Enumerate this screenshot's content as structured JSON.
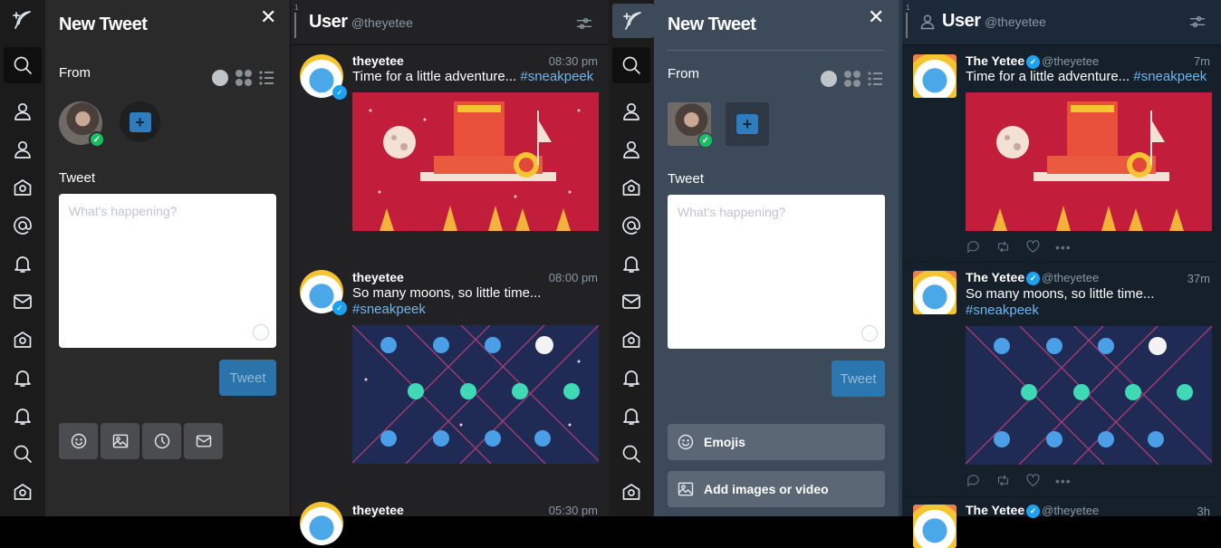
{
  "compose_left": {
    "title": "New Tweet",
    "from_label": "From",
    "tweet_label": "Tweet",
    "placeholder": "What's happening?",
    "tweet_button": "Tweet"
  },
  "compose_right": {
    "title": "New Tweet",
    "from_label": "From",
    "tweet_label": "Tweet",
    "placeholder": "What's happening?",
    "tweet_button": "Tweet",
    "emojis_label": "Emojis",
    "add_media_label": "Add images or video"
  },
  "nav_icons": [
    "search-icon",
    "user-icon",
    "user-icon",
    "home-icon",
    "mention-icon",
    "bell-icon",
    "mail-icon",
    "home-icon",
    "bell-icon",
    "bell-icon",
    "search-icon",
    "home-icon"
  ],
  "column_left": {
    "number": "1",
    "title": "User",
    "handle": "@theyetee",
    "tweets": [
      {
        "name": "theyetee",
        "time": "08:30 pm",
        "text": "Time for a little adventure...",
        "hashtag": "#sneakpeek"
      },
      {
        "name": "theyetee",
        "time": "08:00 pm",
        "text": "So many moons, so little time...",
        "hashtag": "#sneakpeek"
      },
      {
        "name": "theyetee",
        "time": "05:30 pm"
      }
    ]
  },
  "column_right": {
    "number": "1",
    "title": "User",
    "handle": "@theyetee",
    "tweets": [
      {
        "name": "The Yetee",
        "handle": "@theyetee",
        "time": "7m",
        "text": "Time for a little adventure...",
        "hashtag": "#sneakpeek"
      },
      {
        "name": "The Yetee",
        "handle": "@theyetee",
        "time": "37m",
        "text": "So many moons, so little time...",
        "hashtag": "#sneakpeek"
      },
      {
        "name": "The Yetee",
        "handle": "@theyetee",
        "time": "3h"
      }
    ]
  },
  "colors": {
    "compose_dark": "#2a2a2b",
    "compose_blue": "#3d4a59",
    "column_dark": "#222224",
    "column_navy": "#15202b",
    "link": "#6fb6ee",
    "accent": "#1da1f2"
  }
}
